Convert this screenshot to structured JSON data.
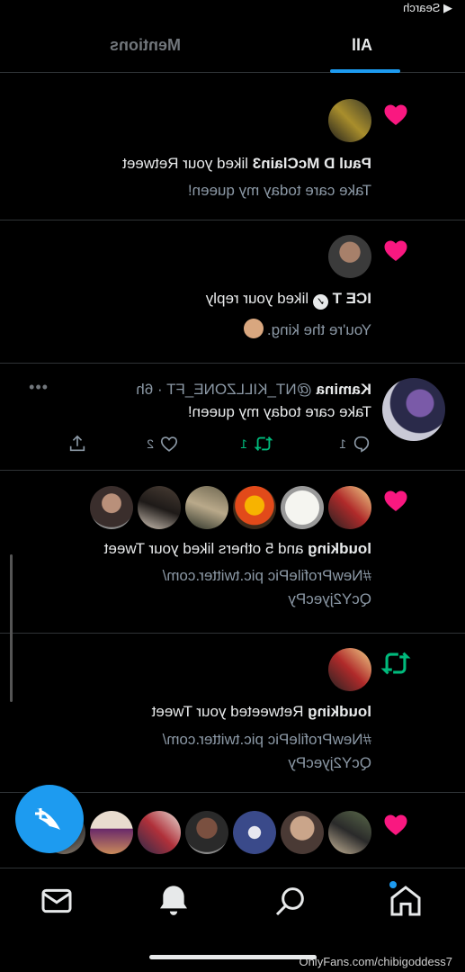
{
  "status": {
    "back_label": "Search"
  },
  "tabs": {
    "all": "All",
    "mentions": "Mentions"
  },
  "notifications": [
    {
      "type": "like",
      "name": "Paul D McClain3",
      "action": " liked your Retweet",
      "snippet": "Take care today my queen!"
    },
    {
      "type": "like",
      "name": "ICE T",
      "action": " liked your reply",
      "snippet": "You're the king."
    },
    {
      "type": "tweet",
      "name": "Kamina",
      "handle": "@NT_KILLZONE_FT · 6h",
      "text": "Take care today my queen!",
      "replies": "1",
      "retweets": "1",
      "likes": "2"
    },
    {
      "type": "like",
      "name": "loudking",
      "action": " and 5 others liked your Tweet",
      "snippet_line1": "#NewProfilePic pic.twitter.com/",
      "snippet_line2": "QcY2jyecPy"
    },
    {
      "type": "retweet",
      "name": "loudking",
      "action": " Retweeted your Tweet",
      "snippet_line1": "#NewProfilePic pic.twitter.com/",
      "snippet_line2": "QcY2jyecPy"
    }
  ],
  "watermark": "OnlyFans.com/chibigoddess7",
  "colors": {
    "accent": "#1d9bf0",
    "like": "#f91880",
    "retweet": "#00ba7c"
  },
  "icons": [
    "home-icon",
    "search-icon",
    "notifications-icon",
    "messages-icon",
    "compose-icon",
    "heart-icon",
    "retweet-icon"
  ]
}
